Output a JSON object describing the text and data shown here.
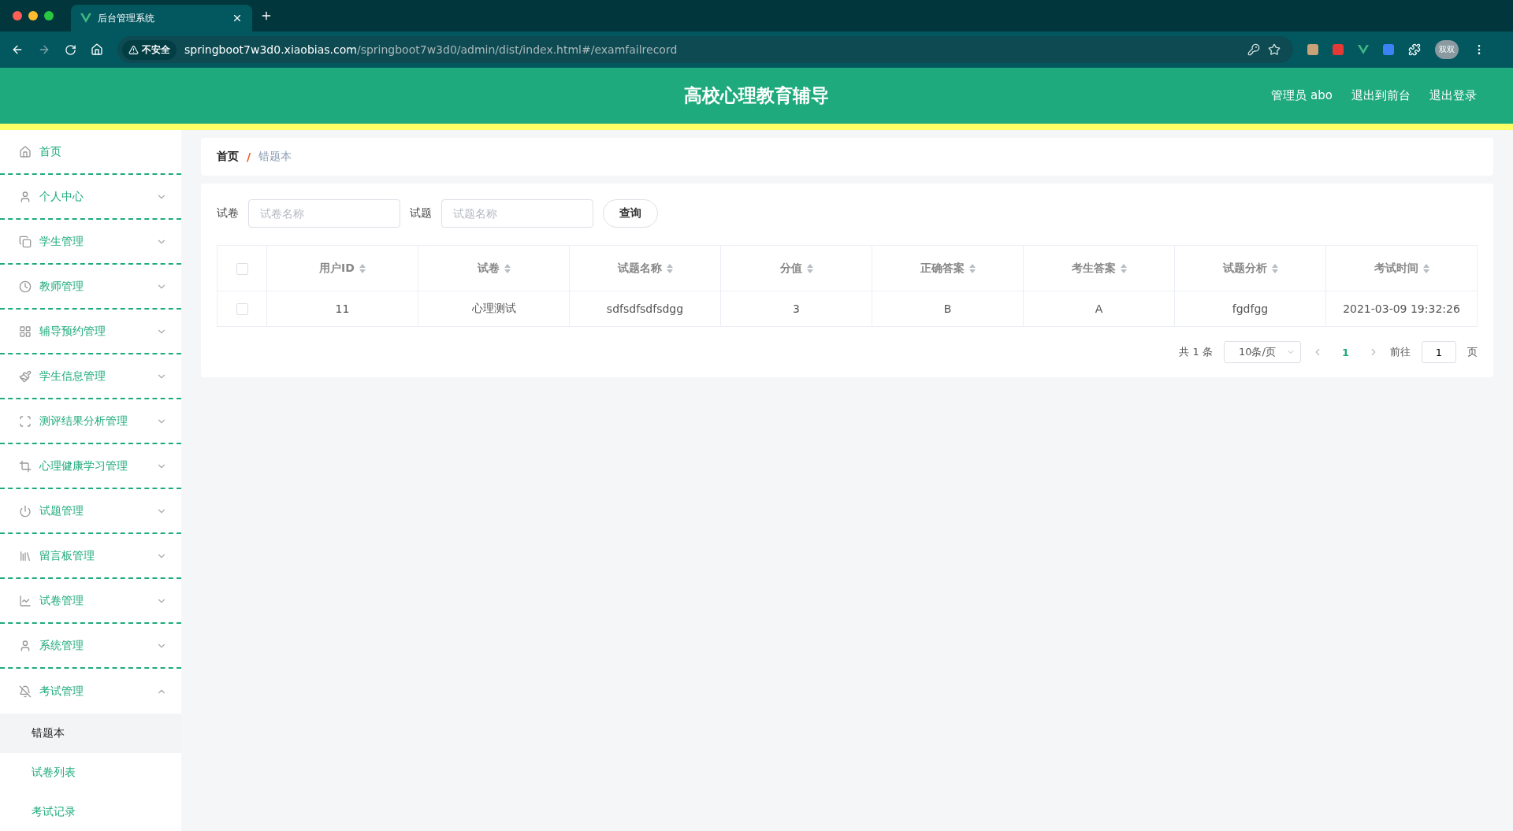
{
  "browser": {
    "tab_title": "后台管理系统",
    "security_label": "不安全",
    "url_host": "springboot7w3d0.xiaobias.com",
    "url_path": "/springboot7w3d0/admin/dist/index.html#/examfailrecord",
    "avatar_text": "双双"
  },
  "header": {
    "title": "高校心理教育辅导",
    "user": "管理员 abo",
    "links": [
      "退出到前台",
      "退出登录"
    ]
  },
  "sidebar": {
    "items": [
      {
        "kind": "link",
        "label": "首页"
      },
      {
        "kind": "submenu",
        "label": "个人中心",
        "expanded": false
      },
      {
        "kind": "submenu",
        "label": "学生管理",
        "expanded": false
      },
      {
        "kind": "submenu",
        "label": "教师管理",
        "expanded": false
      },
      {
        "kind": "submenu",
        "label": "辅导预约管理",
        "expanded": false
      },
      {
        "kind": "submenu",
        "label": "学生信息管理",
        "expanded": false
      },
      {
        "kind": "submenu",
        "label": "测评结果分析管理",
        "expanded": false
      },
      {
        "kind": "submenu",
        "label": "心理健康学习管理",
        "expanded": false
      },
      {
        "kind": "submenu",
        "label": "试题管理",
        "expanded": false
      },
      {
        "kind": "submenu",
        "label": "留言板管理",
        "expanded": false
      },
      {
        "kind": "submenu",
        "label": "试卷管理",
        "expanded": false
      },
      {
        "kind": "submenu",
        "label": "系统管理",
        "expanded": false
      },
      {
        "kind": "submenu",
        "label": "考试管理",
        "expanded": true,
        "children": [
          {
            "label": "错题本",
            "selected": true
          },
          {
            "label": "试卷列表",
            "selected": false
          },
          {
            "label": "考试记录",
            "selected": false
          }
        ]
      }
    ]
  },
  "breadcrumb": [
    {
      "label": "首页"
    },
    {
      "label": "错题本"
    }
  ],
  "breadcrumb_separator": "/",
  "search": {
    "fields": [
      {
        "label": "试卷",
        "placeholder": "试卷名称"
      },
      {
        "label": "试题",
        "placeholder": "试题名称"
      }
    ],
    "button": "查询"
  },
  "table": {
    "select_all": {
      "checked": false
    },
    "columns": [
      "用户ID",
      "试卷",
      "试题名称",
      "分值",
      "正确答案",
      "考生答案",
      "试题分析",
      "考试时间"
    ],
    "rows": [
      {
        "checked": false,
        "cells": [
          "11",
          "心理测试",
          "sdfsdfsdfsdgg",
          "3",
          "B",
          "A",
          "fgdfgg",
          "2021-03-09 19:32:26"
        ]
      }
    ]
  },
  "pagination": {
    "total": "共 1 条",
    "page_size": "10条/页",
    "pages": [
      {
        "label": "1",
        "selected": true
      }
    ],
    "goto_label": "前往",
    "goto_value": "1",
    "goto_suffix": "页"
  }
}
